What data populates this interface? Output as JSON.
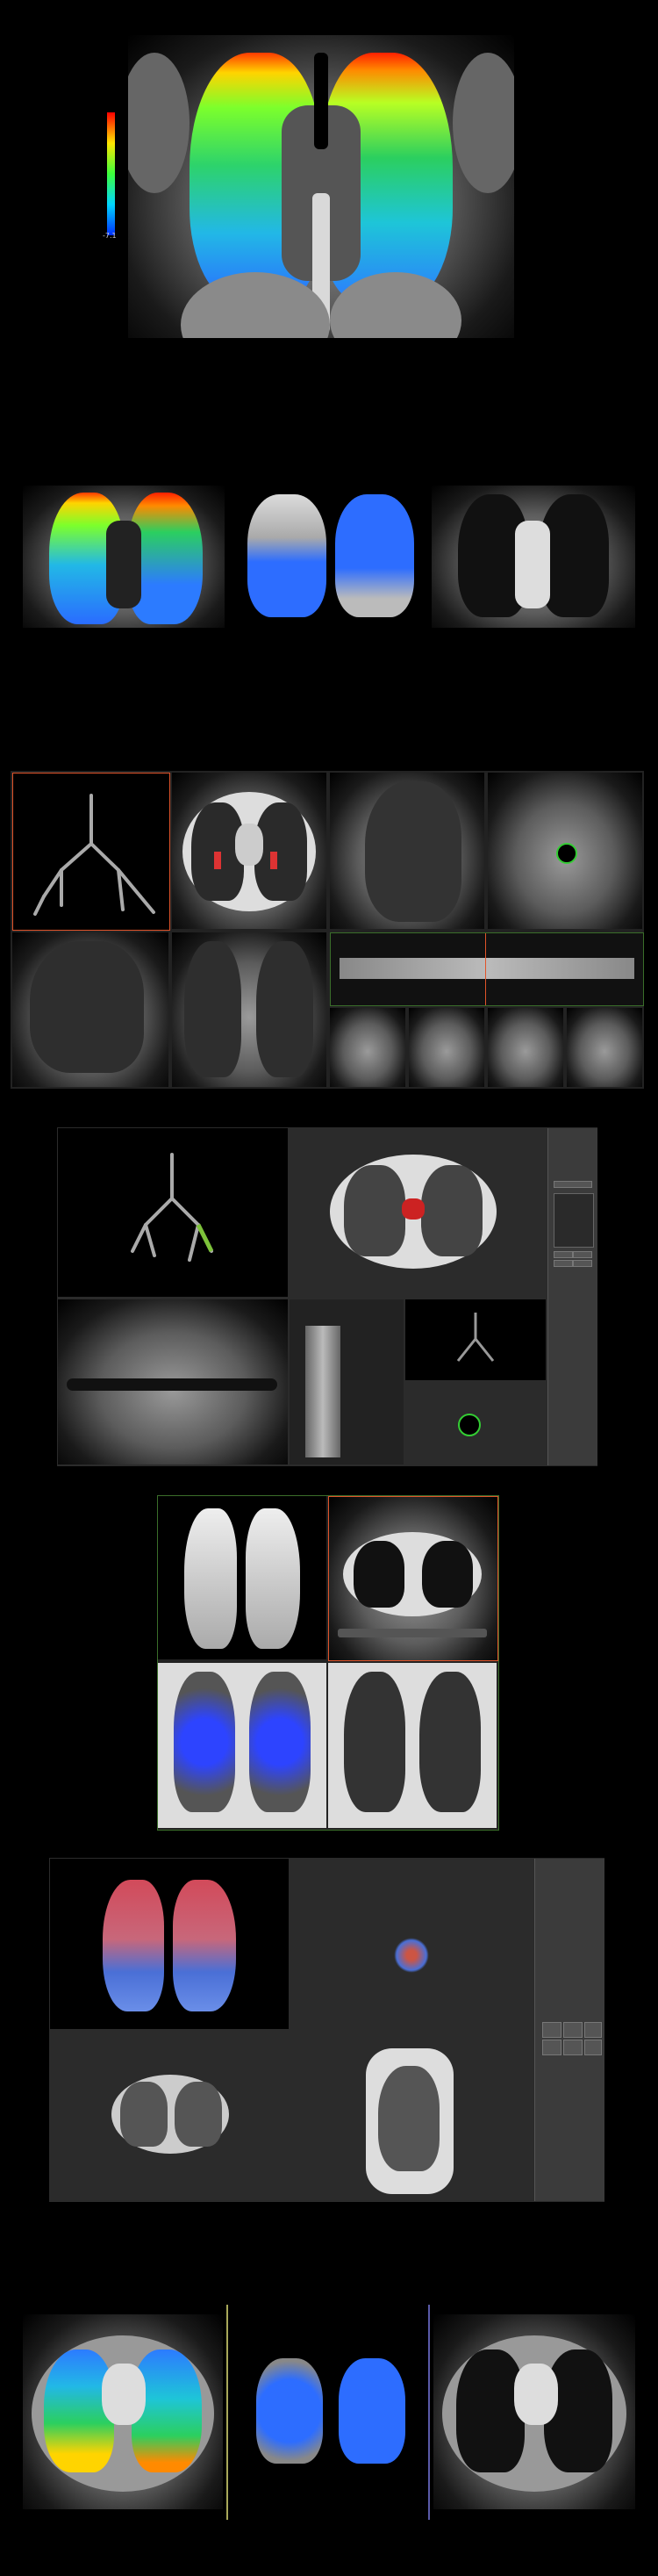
{
  "colors": {
    "accent_orange": "#e0542a",
    "green_divider": "#3a6e2a",
    "yellow_overlay": "#e6e600",
    "blue_overlay": "#2d6dff"
  },
  "colorbar": {
    "top_label": "",
    "bottom_label": "-7.1"
  },
  "icons": [
    "crosshair-icon",
    "lung-icon"
  ]
}
